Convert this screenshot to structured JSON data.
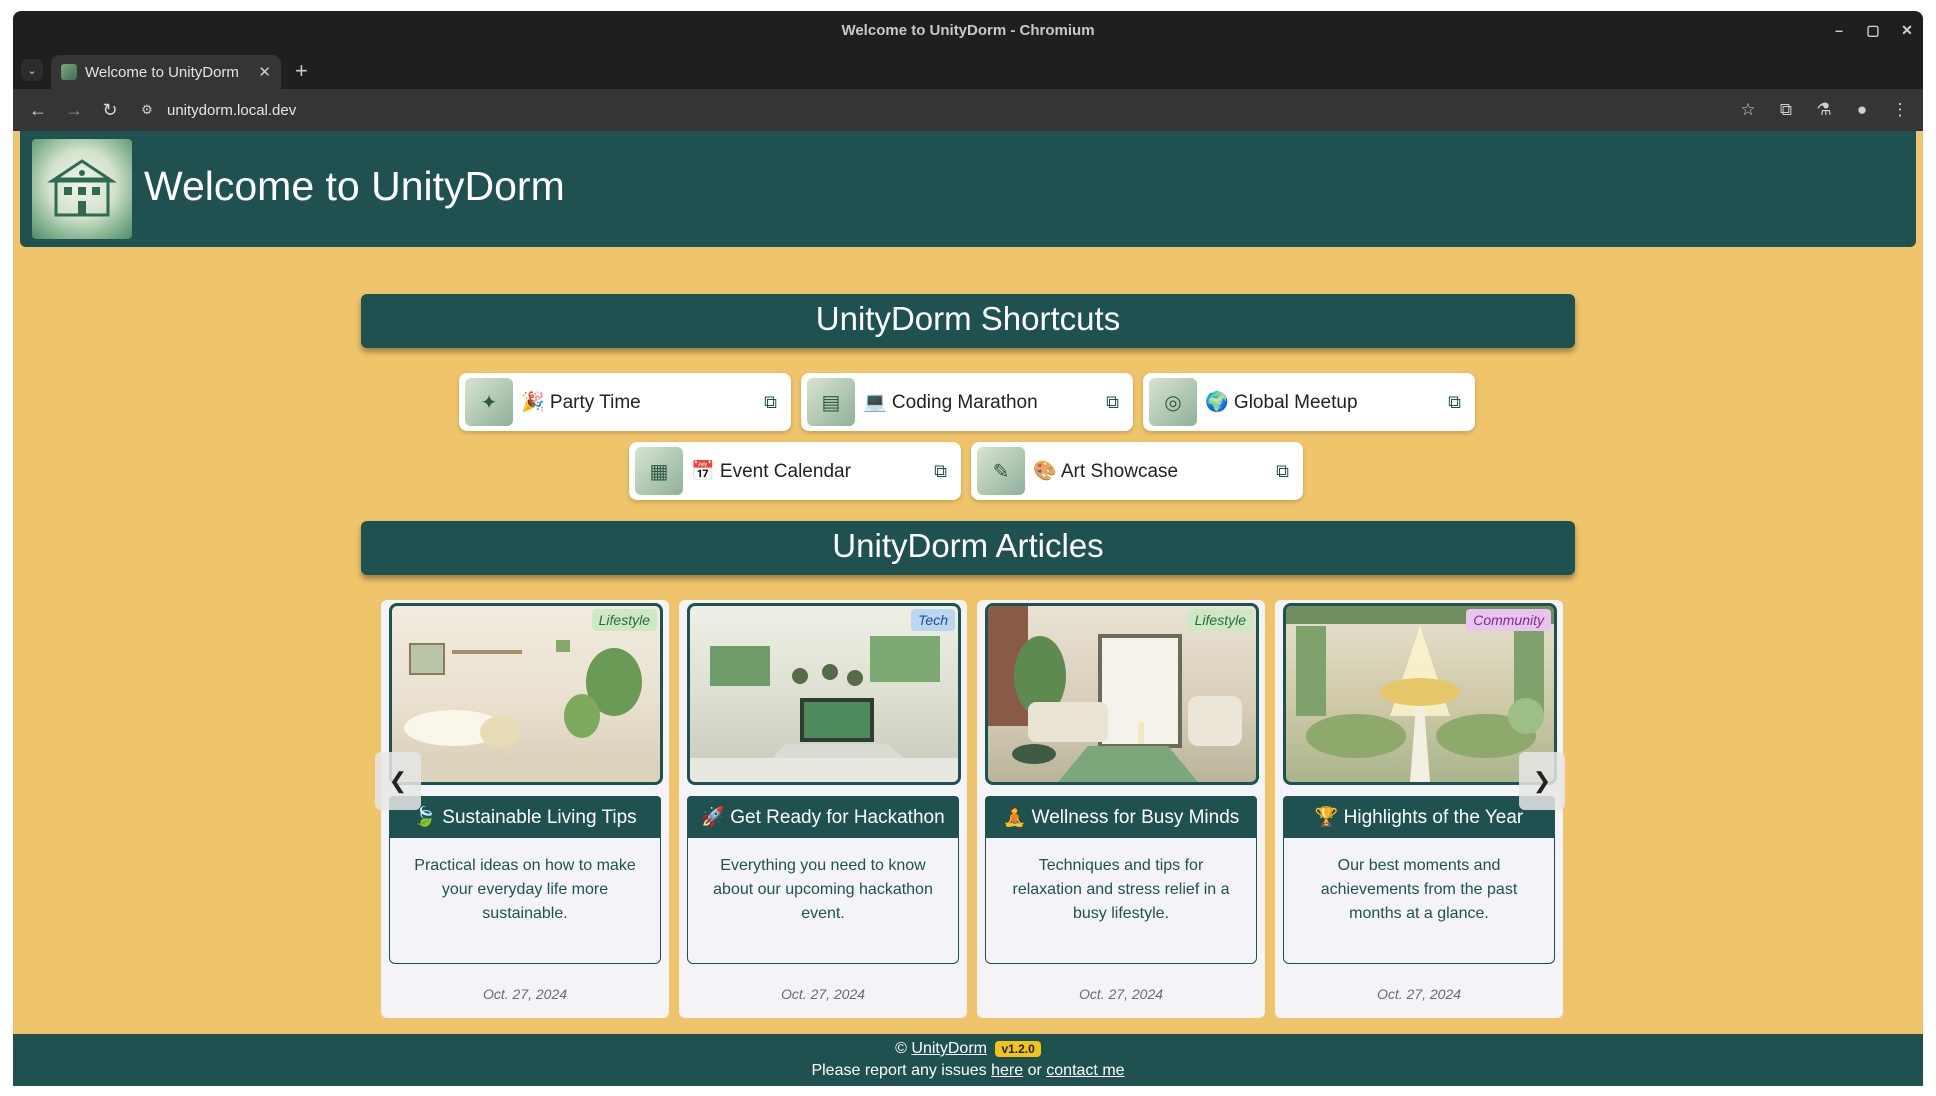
{
  "browser": {
    "window_title": "Welcome to UnityDorm - Chromium",
    "tab_title": "Welcome to UnityDorm",
    "url": "unitydorm.local.dev",
    "controls": {
      "minimize": "–",
      "maximize": "▢",
      "close": "✕"
    }
  },
  "header": {
    "title": "Welcome to UnityDorm"
  },
  "shortcuts": {
    "heading": "UnityDorm Shortcuts",
    "items": [
      {
        "label": "🎉 Party Time",
        "icon": "party-icon"
      },
      {
        "label": "💻 Coding Marathon",
        "icon": "laptop-icon"
      },
      {
        "label": "🌍 Global Meetup",
        "icon": "globe-icon"
      },
      {
        "label": "📅 Event Calendar",
        "icon": "calendar-icon"
      },
      {
        "label": "🎨 Art Showcase",
        "icon": "palette-icon"
      }
    ]
  },
  "articles": {
    "heading": "UnityDorm Articles",
    "items": [
      {
        "tag": "Lifestyle",
        "title": "🍃 Sustainable Living Tips",
        "summary": "Practical ideas on how to make your everyday life more sustainable.",
        "date": "Oct. 27, 2024"
      },
      {
        "tag": "Tech",
        "title": "🚀 Get Ready for Hackathon",
        "summary": "Everything you need to know about our upcoming hackathon event.",
        "date": "Oct. 27, 2024"
      },
      {
        "tag": "Lifestyle",
        "title": "🧘 Wellness for Busy Minds",
        "summary": "Techniques and tips for relaxation and stress relief in a busy lifestyle.",
        "date": "Oct. 27, 2024"
      },
      {
        "tag": "Community",
        "title": "🏆 Highlights of the Year",
        "summary": "Our best moments and achievements from the past months at a glance.",
        "date": "Oct. 27, 2024"
      }
    ],
    "prev": "❮",
    "next": "❯"
  },
  "footer": {
    "copyright": "©",
    "brand": "UnityDorm",
    "version": "v1.2.0",
    "report_prefix": "Please report any issues",
    "here": "here",
    "or": "or",
    "contact": "contact me"
  },
  "colors": {
    "page_bg": "#efc46a",
    "primary": "#1e5150",
    "badge_lifestyle": "#cfe8c4",
    "badge_tech": "#bcd6f2",
    "badge_community": "#e8c4ee",
    "version_badge": "#f3c318"
  }
}
